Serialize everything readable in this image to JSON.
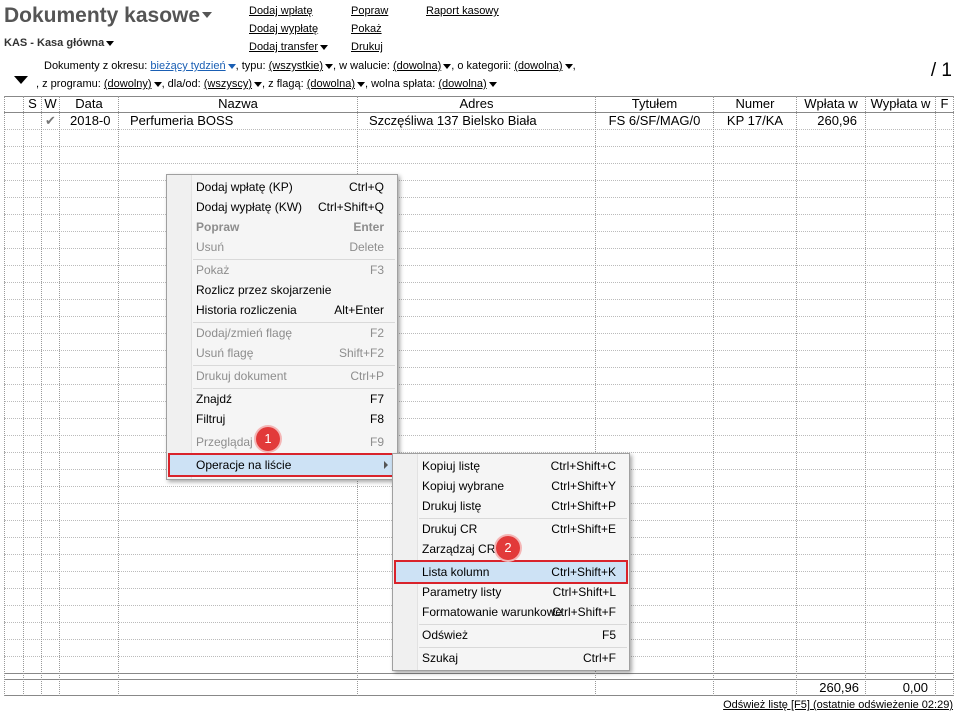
{
  "header": {
    "title": "Dokumenty kasowe",
    "subtitle": "KAS - Kasa główna",
    "page_indicator": "/ 1"
  },
  "actions": {
    "col1": [
      "Dodaj wpłatę",
      "Dodaj wypłatę",
      "Dodaj transfer"
    ],
    "col2": [
      "Popraw",
      "Pokaż",
      "Drukuj"
    ],
    "col3": [
      "Raport kasowy"
    ]
  },
  "filters": {
    "period_label": "Dokumenty z okresu:",
    "period_value": "bieżący tydzień",
    "type_label": ", typu:",
    "type_value": "(wszystkie)",
    "currency_label": ", w walucie:",
    "currency_value": "(dowolna)",
    "category_label": ", o kategorii:",
    "category_value": "(dowolna)",
    "category_tail": ",",
    "program_label": ", z programu:",
    "program_value": "(dowolny)",
    "for_label": ", dla/od:",
    "for_value": "(wszyscy)",
    "flag_label": ", z flagą:",
    "flag_value": "(dowolna)",
    "payment_label": ", wolna spłata:",
    "payment_value": "(dowolna)"
  },
  "table": {
    "columns": [
      "S",
      "W",
      "Data",
      "Nazwa",
      "Adres",
      "Tytułem",
      "Numer",
      "Wpłata w",
      "Wypłata w",
      "F"
    ],
    "rows": [
      {
        "check": "✔",
        "data": "2018-0",
        "nazwa": "Perfumeria BOSS",
        "adres": "Szczęśliwa  137  Bielsko Biała",
        "tytulem": "FS 6/SF/MAG/0",
        "numer": "KP 17/KA",
        "wplata": "260,96",
        "wyplata": ""
      }
    ],
    "totals": {
      "wplata": "260,96",
      "wyplata": "0,00"
    }
  },
  "context_menu": {
    "items": [
      {
        "label": "Dodaj wpłatę (KP)",
        "shortcut": "Ctrl+Q",
        "disabled": false
      },
      {
        "label": "Dodaj wypłatę (KW)",
        "shortcut": "Ctrl+Shift+Q",
        "disabled": false
      },
      {
        "label": "Popraw",
        "shortcut": "Enter",
        "disabled": true
      },
      {
        "label": "Usuń",
        "shortcut": "Delete",
        "disabled": true
      },
      {
        "label": "Pokaż",
        "shortcut": "F3",
        "disabled": true
      },
      {
        "label": "Rozlicz przez skojarzenie",
        "shortcut": "",
        "disabled": false
      },
      {
        "label": "Historia rozliczenia",
        "shortcut": "Alt+Enter",
        "disabled": false
      },
      {
        "label": "Dodaj/zmień flagę",
        "shortcut": "F2",
        "disabled": true
      },
      {
        "label": "Usuń flagę",
        "shortcut": "Shift+F2",
        "disabled": true
      },
      {
        "label": "Drukuj dokument",
        "shortcut": "Ctrl+P",
        "disabled": true
      },
      {
        "label": "Znajdź",
        "shortcut": "F7",
        "disabled": false
      },
      {
        "label": "Filtruj",
        "shortcut": "F8",
        "disabled": false
      },
      {
        "label": "Przeglądaj",
        "shortcut": "F9",
        "disabled": true
      },
      {
        "label": "Operacje na liście",
        "shortcut": "",
        "disabled": false
      }
    ]
  },
  "submenu": {
    "items": [
      {
        "label": "Kopiuj listę",
        "shortcut": "Ctrl+Shift+C"
      },
      {
        "label": "Kopiuj wybrane",
        "shortcut": "Ctrl+Shift+Y"
      },
      {
        "label": "Drukuj listę",
        "shortcut": "Ctrl+Shift+P"
      },
      {
        "label": "Drukuj CR",
        "shortcut": "Ctrl+Shift+E"
      },
      {
        "label": "Zarządzaj CR",
        "shortcut": ""
      },
      {
        "label": "Lista kolumn",
        "shortcut": "Ctrl+Shift+K"
      },
      {
        "label": "Parametry listy",
        "shortcut": "Ctrl+Shift+L"
      },
      {
        "label": "Formatowanie warunkowe",
        "shortcut": "Ctrl+Shift+F"
      },
      {
        "label": "Odśwież",
        "shortcut": "F5"
      },
      {
        "label": "Szukaj",
        "shortcut": "Ctrl+F"
      }
    ]
  },
  "badges": {
    "one": "1",
    "two": "2"
  },
  "footer": {
    "refresh": "Odśwież listę [F5] (ostatnie odświeżenie 02:29)"
  },
  "colors": {
    "highlight_border": "#d9232b",
    "highlight_bg": "#cde2f5",
    "badge": "#e23a3a",
    "link_blue": "#1a5fb4"
  }
}
